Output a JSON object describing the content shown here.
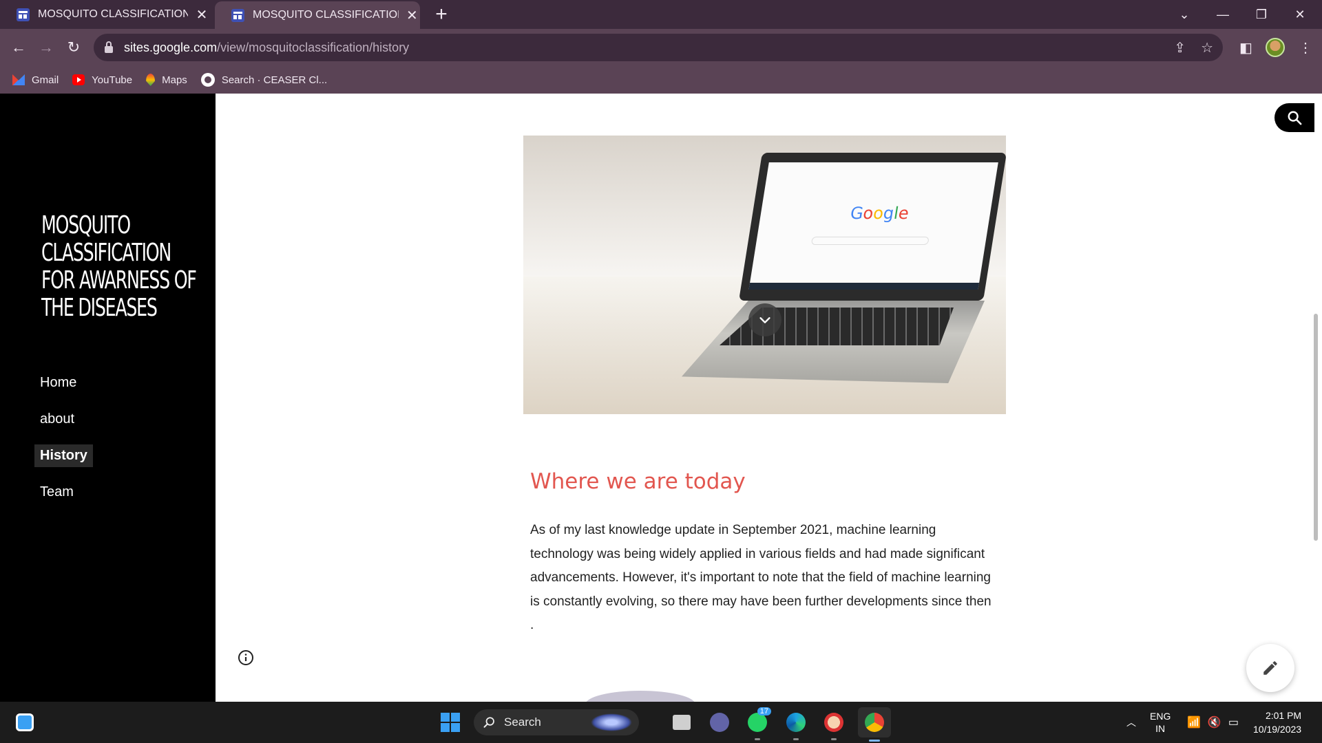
{
  "browser": {
    "tabs": [
      {
        "title": "MOSQUITO CLASSIFICATION FO",
        "active": false
      },
      {
        "title": "MOSQUITO CLASSIFICATION FO",
        "active": true
      }
    ],
    "url_host": "sites.google.com",
    "url_path": "/view/mosquitoclassification/history",
    "bookmarks": [
      {
        "label": "Gmail",
        "icon": "gmail-icon"
      },
      {
        "label": "YouTube",
        "icon": "youtube-icon"
      },
      {
        "label": "Maps",
        "icon": "maps-icon"
      },
      {
        "label": "Search · CEASER Cl...",
        "icon": "github-icon"
      }
    ],
    "theme_colors": {
      "tabstrip": "#3c2a3c",
      "toolbar": "#5a4355"
    }
  },
  "site": {
    "title": "MOSQUITO CLASSIFICATION FOR AWARNESS OF THE DISEASES",
    "nav": [
      {
        "label": "Home",
        "current": false
      },
      {
        "label": "about",
        "current": false
      },
      {
        "label": "History",
        "current": true
      },
      {
        "label": "Team",
        "current": false
      }
    ],
    "hero_screen_text": "Google"
  },
  "content": {
    "heading": "Where we are today",
    "heading_color": "#e2564f",
    "body": "As of my last knowledge update in September 2021, machine learning technology was being widely applied in various fields and had made significant advancements. However, it's important to note that the field of machine learning is constantly evolving, so there may have been further developments since then ."
  },
  "taskbar": {
    "search_placeholder": "Search",
    "whatsapp_badge": "17",
    "language_line1": "ENG",
    "language_line2": "IN",
    "time": "2:01 PM",
    "date": "10/19/2023"
  }
}
